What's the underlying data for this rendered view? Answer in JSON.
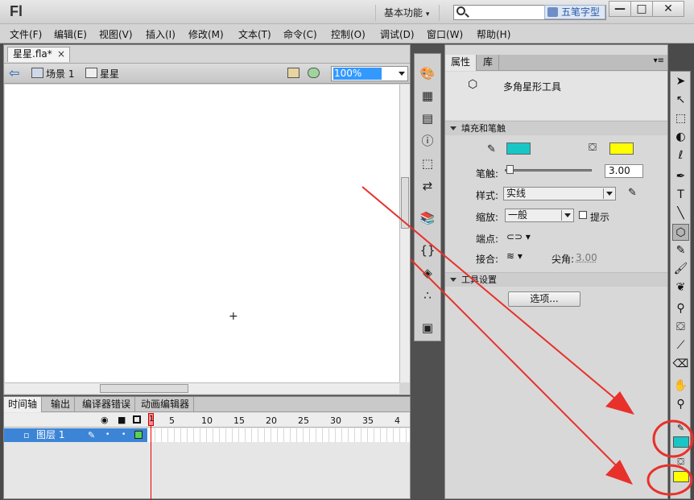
{
  "app": {
    "logo": "Fl",
    "workspace": "基本功能",
    "ime_label": "五笔字型"
  },
  "window_buttons": {
    "minimize": "—",
    "maximize": "□",
    "close": "✕"
  },
  "menu": [
    "文件(F)",
    "编辑(E)",
    "视图(V)",
    "插入(I)",
    "修改(M)",
    "文本(T)",
    "命令(C)",
    "控制(O)",
    "调试(D)",
    "窗口(W)",
    "帮助(H)"
  ],
  "document": {
    "tab_label": "星星.fla*",
    "breadcrumb": [
      "场景 1",
      "星星"
    ],
    "zoom": "100%"
  },
  "timeline": {
    "tabs": [
      "时间轴",
      "输出",
      "编译器错误",
      "动画编辑器"
    ],
    "frame_numbers": [
      "1",
      "5",
      "10",
      "15",
      "20",
      "25",
      "30",
      "35",
      "4"
    ],
    "layer_name": "图层 1"
  },
  "properties": {
    "tabs": [
      "属性",
      "库"
    ],
    "tool_name": "多角星形工具",
    "section_fill_stroke": "填充和笔触",
    "stroke_label": "笔触:",
    "stroke_value": "3.00",
    "style_label": "样式:",
    "style_value": "实线",
    "scale_label": "缩放:",
    "scale_value": "一般",
    "hint_label": "提示",
    "cap_label": "端点:",
    "join_label": "接合:",
    "miter_label": "尖角:",
    "miter_value": "3.00",
    "section_tool_settings": "工具设置",
    "options_button": "选项..."
  },
  "colors": {
    "stroke": "#17c6c6",
    "fill": "#ffff00",
    "annotation": "#e8312a",
    "selected_layer": "#3c85d6"
  },
  "icons": [
    "search-icon",
    "back-arrow-icon",
    "scene-icon",
    "symbol-icon",
    "edit-scene-icon",
    "edit-symbol-icon",
    "polystar-icon",
    "pencil-icon",
    "fill-bucket-icon",
    "eye-icon",
    "lock-icon",
    "outline-icon"
  ]
}
